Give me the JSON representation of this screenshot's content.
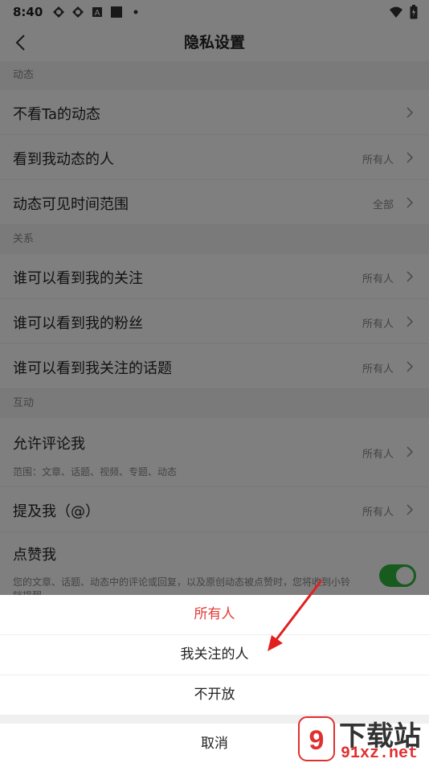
{
  "status_bar": {
    "time": "8:40"
  },
  "header": {
    "title": "隐私设置"
  },
  "sections": [
    {
      "title": "动态",
      "rows": [
        {
          "label": "不看Ta的动态",
          "value": ""
        },
        {
          "label": "看到我动态的人",
          "value": "所有人"
        },
        {
          "label": "动态可见时间范围",
          "value": "全部"
        }
      ]
    },
    {
      "title": "关系",
      "rows": [
        {
          "label": "谁可以看到我的关注",
          "value": "所有人"
        },
        {
          "label": "谁可以看到我的粉丝",
          "value": "所有人"
        },
        {
          "label": "谁可以看到我关注的话题",
          "value": "所有人"
        }
      ]
    },
    {
      "title": "互动",
      "rows": [
        {
          "label": "允许评论我",
          "value": "所有人",
          "desc": "范围：文章、话题、视频、专题、动态"
        },
        {
          "label": "提及我（@）",
          "value": "所有人"
        },
        {
          "label": "点赞我",
          "desc": "您的文章、话题、动态中的评论或回复，以及原创动态被点赞时，您将收到小铃铛提醒",
          "toggle_on": true
        }
      ]
    }
  ],
  "sheet": {
    "options": [
      "所有人",
      "我关注的人",
      "不开放"
    ],
    "selected_index": 0,
    "cancel": "取消"
  },
  "watermark": {
    "text": "下载站",
    "domain": "91xz.net"
  },
  "colors": {
    "selected": "#e53935",
    "toggle_on": "#2eb83d",
    "arrow": "#e02020"
  }
}
